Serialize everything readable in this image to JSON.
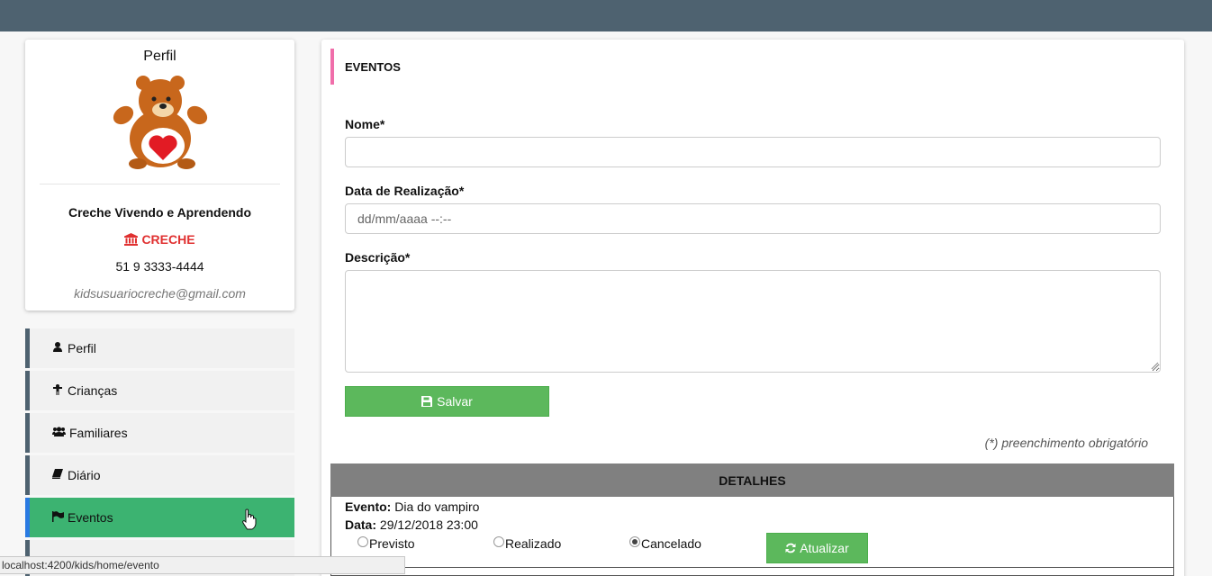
{
  "profile": {
    "title": "Perfil",
    "org_name": "Creche Vivendo e Aprendendo",
    "org_type": "CRECHE",
    "phone": "51 9 3333-4444",
    "email": "kidsusuariocreche@gmail.com"
  },
  "nav": {
    "items": [
      {
        "label": "Perfil",
        "icon": "user-icon"
      },
      {
        "label": "Crianças",
        "icon": "child-icon"
      },
      {
        "label": "Familiares",
        "icon": "users-icon"
      },
      {
        "label": "Diário",
        "icon": "book-icon"
      },
      {
        "label": "Eventos",
        "icon": "flag-icon",
        "active": true
      }
    ]
  },
  "form": {
    "section_title": "EVENTOS",
    "name_label": "Nome*",
    "name_value": "",
    "date_label": "Data de Realização*",
    "date_placeholder": "dd/mm/aaaa --:--",
    "description_label": "Descrição*",
    "description_value": "",
    "save_label": "Salvar",
    "required_note": "(*) preenchimento obrigatório"
  },
  "details": {
    "header": "DETALHES",
    "event_label": "Evento:",
    "event_value": "Dia do vampiro",
    "date_label": "Data:",
    "date_value": "29/12/2018 23:00",
    "status_options": [
      {
        "label": "Previsto",
        "checked": false
      },
      {
        "label": "Realizado",
        "checked": false
      },
      {
        "label": "Cancelado",
        "checked": true
      }
    ],
    "update_label": "Atualizar"
  },
  "statusbar": {
    "url": "localhost:4200/kids/home/evento"
  },
  "colors": {
    "topbar": "#4e6270",
    "accent_pink": "#f06eaa",
    "success_green": "#5cb85c",
    "nav_active": "#3cb371",
    "org_red": "#e03131"
  }
}
